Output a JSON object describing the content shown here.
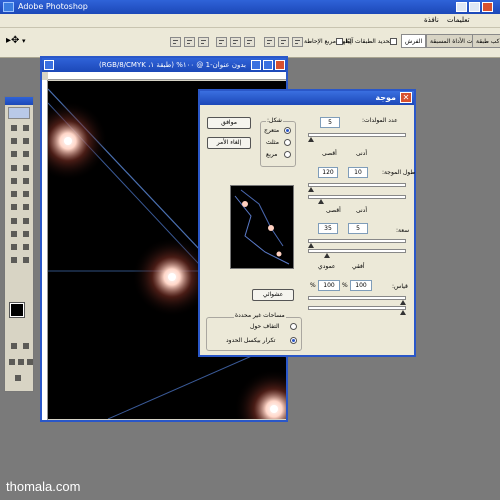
{
  "app": {
    "title": "Adobe Photoshop",
    "menu": [
      "تعليمات",
      "نافذة"
    ]
  },
  "options_bar": {
    "mirror_check_label": "إظهار مربع الإحاطة",
    "auto_select_label": "تحديد الطبقات آليًا",
    "palette_tabs": [
      "الفرش",
      "إعدادات الأداة المسبقة",
      "تراكب طبقة"
    ]
  },
  "document": {
    "title": "بدون عنوان-1 @ ١٠٠% (طبقة ١، RGB/8/CMYK)"
  },
  "dialog": {
    "title": "موجة",
    "ok_label": "موافق",
    "cancel_label": "إلغاء الأمر",
    "generators": {
      "label": "عدد المولدات:",
      "value": "5"
    },
    "min_label": "أدنى",
    "max_label": "أقصى",
    "wavelength": {
      "label": "طول الموجة:",
      "min": "10",
      "max": "120"
    },
    "amplitude": {
      "label": "سعة:",
      "min": "5",
      "max": "35"
    },
    "scale": {
      "label": "قياس:",
      "h": "100",
      "v": "100",
      "h_unit": "%",
      "v_unit": "%",
      "horizontal_label": "أفقي",
      "vertical_label": "عمودي"
    },
    "type": {
      "label": "شكل:",
      "options": [
        "متعرج",
        "مثلث",
        "مربع"
      ],
      "selected": "متعرج"
    },
    "randomize_label": "عشوائي",
    "undefined_areas": {
      "label": "مساحات غير محددة",
      "options": [
        "التفاف حول",
        "تكرار بيكسل الحدود"
      ],
      "selected": "تكرار بيكسل الحدود"
    }
  },
  "watermark": "thomala.com"
}
